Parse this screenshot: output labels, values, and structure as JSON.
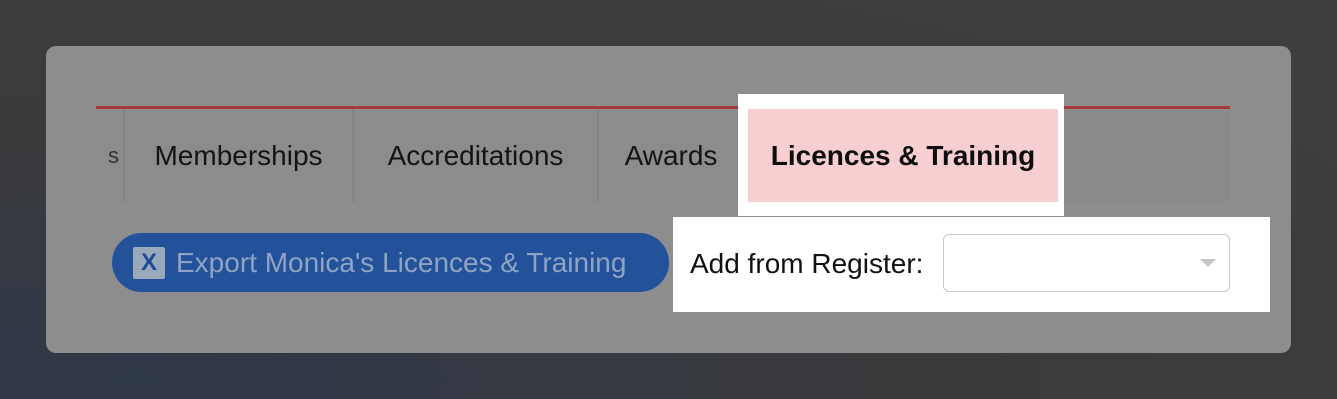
{
  "tabs": {
    "partial_label": "s",
    "items": [
      {
        "label": "Memberships"
      },
      {
        "label": "Accreditations"
      },
      {
        "label": "Awards"
      },
      {
        "label": "Licences & Training",
        "active": true
      }
    ]
  },
  "export_button": {
    "icon": "X",
    "label": "Export Monica's Licences & Training"
  },
  "register": {
    "label": "Add from Register:",
    "selected_value": ""
  },
  "colors": {
    "accent_red": "#a63a3a",
    "active_tab": "#f7cfd0",
    "export_blue": "#23529b"
  }
}
